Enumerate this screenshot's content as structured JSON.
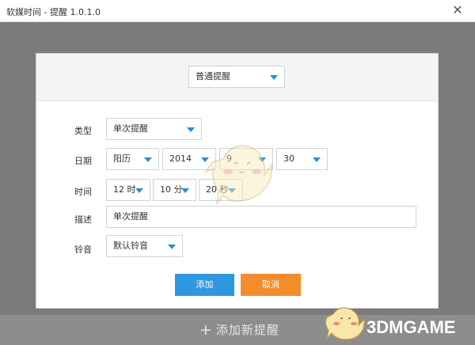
{
  "window": {
    "title": "软媒时间 - 提醒 1.0.1.0",
    "close_glyph": "✕"
  },
  "dialog": {
    "header_select": "普通提醒",
    "fields": {
      "type": {
        "label": "类型",
        "value": "单次提醒"
      },
      "date": {
        "label": "日期",
        "calendar": "阳历",
        "year": "2014",
        "month": "9",
        "day": "30"
      },
      "time": {
        "label": "时间",
        "hour": "12 时",
        "minute": "10 分",
        "second": "20 秒"
      },
      "desc": {
        "label": "描述",
        "value": "单次提醒"
      },
      "sound": {
        "label": "铃音",
        "value": "默认铃音"
      }
    },
    "buttons": {
      "add": "添加",
      "cancel": "取消"
    }
  },
  "footer": {
    "add_new_icon": "+",
    "add_new_label": "添加新提醒"
  },
  "watermark": "3DMGAME",
  "colors": {
    "accent_blue": "#2f97e0",
    "accent_orange": "#f38d2b",
    "caret_blue": "#2a8fd0"
  }
}
